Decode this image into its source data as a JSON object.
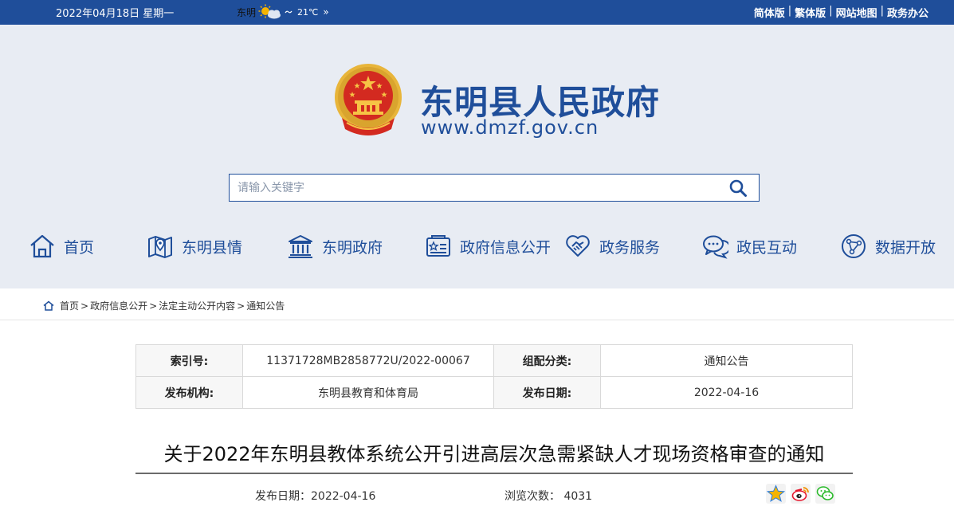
{
  "topbar": {
    "date": "2022年04月18日 星期一",
    "weather_city": "东明",
    "weather_temp": "21℃",
    "weather_more": "»",
    "links": [
      "简体版",
      "繁体版",
      "网站地图",
      "政务办公"
    ]
  },
  "header": {
    "title": "东明县人民政府",
    "url": "www.dmzf.gov.cn"
  },
  "search": {
    "placeholder": "请输入关键字"
  },
  "nav": [
    {
      "label": "首页",
      "icon": "home-icon"
    },
    {
      "label": "东明县情",
      "icon": "map-icon"
    },
    {
      "label": "东明政府",
      "icon": "government-building-icon"
    },
    {
      "label": "政府信息公开",
      "icon": "info-card-icon"
    },
    {
      "label": "政务服务",
      "icon": "handshake-icon"
    },
    {
      "label": "政民互动",
      "icon": "chat-icon"
    },
    {
      "label": "数据开放",
      "icon": "network-icon"
    }
  ],
  "breadcrumb": [
    "首页",
    "政府信息公开",
    "法定主动公开内容",
    "通知公告"
  ],
  "info": {
    "index_label": "索引号:",
    "index_value": "11371728MB2858772U/2022-00067",
    "category_label": "组配分类:",
    "category_value": "通知公告",
    "org_label": "发布机构:",
    "org_value": "东明县教育和体育局",
    "pubdate_label": "发布日期:",
    "pubdate_value": "2022-04-16"
  },
  "article": {
    "title": "关于2022年东明县教体系统公开引进高层次急需紧缺人才现场资格审查的通知",
    "date": "发布日期：2022-04-16",
    "views": "浏览次数： 4031"
  },
  "colors": {
    "brand_blue": "#1f4e9a",
    "header_bg": "#e8ecf3"
  }
}
